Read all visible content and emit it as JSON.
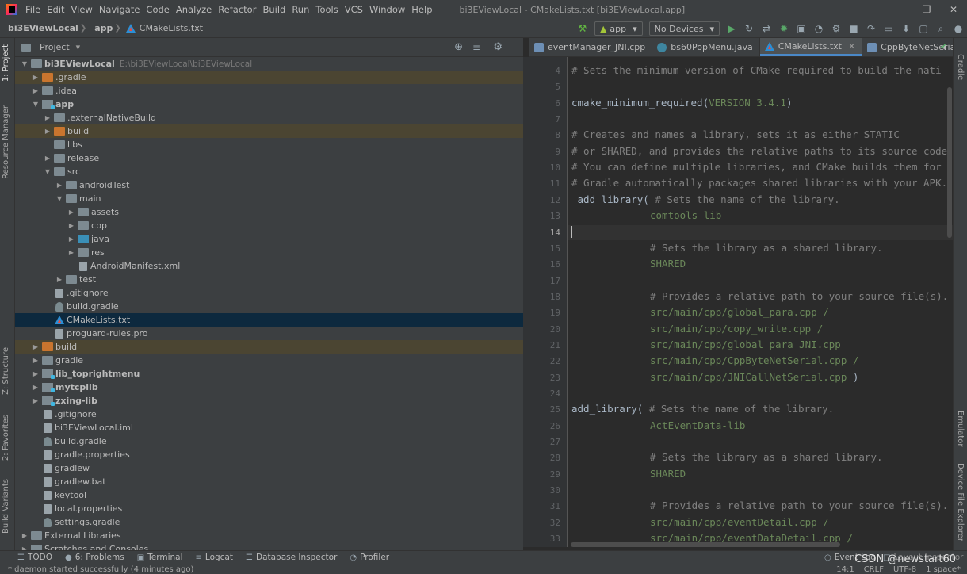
{
  "menubar": {
    "items": [
      "File",
      "Edit",
      "View",
      "Navigate",
      "Code",
      "Analyze",
      "Refactor",
      "Build",
      "Run",
      "Tools",
      "VCS",
      "Window",
      "Help"
    ],
    "title": "bi3EViewLocal - CMakeLists.txt [bi3EViewLocal.app]"
  },
  "navbar": {
    "crumbs": [
      "bi3EViewLocal",
      "app",
      "CMakeLists.txt"
    ],
    "run_config": "app",
    "device": "No Devices"
  },
  "left_strip": [
    "1: Project",
    "Resource Manager",
    "Z: Structure",
    "2: Favorites",
    "Build Variants"
  ],
  "right_strip": [
    "Gradle",
    "Emulator",
    "Device File Explorer"
  ],
  "project": {
    "title": "Project",
    "root_name": "bi3EViewLocal",
    "root_path": "E:\\bi3EViewLocal\\bi3EViewLocal",
    "rows": [
      {
        "label": ".gradle"
      },
      {
        "label": ".idea"
      },
      {
        "label": "app"
      },
      {
        "label": ".externalNativeBuild"
      },
      {
        "label": "build"
      },
      {
        "label": "libs"
      },
      {
        "label": "release"
      },
      {
        "label": "src"
      },
      {
        "label": "androidTest"
      },
      {
        "label": "main"
      },
      {
        "label": "assets"
      },
      {
        "label": "cpp"
      },
      {
        "label": "java"
      },
      {
        "label": "res"
      },
      {
        "label": "AndroidManifest.xml"
      },
      {
        "label": "test"
      },
      {
        "label": ".gitignore"
      },
      {
        "label": "build.gradle"
      },
      {
        "label": "CMakeLists.txt"
      },
      {
        "label": "proguard-rules.pro"
      },
      {
        "label": "build"
      },
      {
        "label": "gradle"
      },
      {
        "label": "lib_toprightmenu"
      },
      {
        "label": "mytcplib"
      },
      {
        "label": "zxing-lib"
      },
      {
        "label": ".gitignore"
      },
      {
        "label": "bi3EViewLocal.iml"
      },
      {
        "label": "build.gradle"
      },
      {
        "label": "gradle.properties"
      },
      {
        "label": "gradlew"
      },
      {
        "label": "gradlew.bat"
      },
      {
        "label": "keytool"
      },
      {
        "label": "local.properties"
      },
      {
        "label": "settings.gradle"
      },
      {
        "label": "External Libraries"
      },
      {
        "label": "Scratches and Consoles"
      }
    ]
  },
  "editor": {
    "tabs": [
      "eventManager_JNI.cpp",
      "bs60PopMenu.java",
      "CMakeLists.txt",
      "CppByteNetSerial."
    ],
    "active_tab": "CMakeLists.txt",
    "line_numbers": [
      "4",
      "5",
      "6",
      "7",
      "8",
      "9",
      "10",
      "11",
      "12",
      "13",
      "14",
      "15",
      "16",
      "17",
      "18",
      "19",
      "20",
      "21",
      "22",
      "23",
      "24",
      "25",
      "26",
      "27",
      "28",
      "29",
      "30",
      "31",
      "32",
      "33"
    ],
    "current_line": "14",
    "lines": {
      "l4": "# Sets the minimum version of CMake required to build the nati",
      "l6a": "cmake_minimum_required(",
      "l6b": "VERSION 3.4.1",
      "l6c": ")",
      "l8": "# Creates and names a library, sets it as either STATIC",
      "l9": "# or SHARED, and provides the relative paths to its source code",
      "l10": "# You can define multiple libraries, and CMake builds them for",
      "l11": "# Gradle automatically packages shared libraries with your APK.",
      "l12a": " add_library( ",
      "l12b": "# Sets the name of the library.",
      "l13": "comtools-lib",
      "l15": "# Sets the library as a shared library.",
      "l16": "SHARED",
      "l18": "# Provides a relative path to your source file(s).",
      "l19": "src/main/cpp/global_para.cpp /",
      "l20": "src/main/cpp/copy_write.cpp /",
      "l21": "src/main/cpp/global_para_JNI.cpp",
      "l22": "src/main/cpp/CppByteNetSerial.cpp /",
      "l23a": "src/main/cpp/JNICallNetSerial.cpp",
      "l23b": " )",
      "l25a": "add_library( ",
      "l25b": "# Sets the name of the library.",
      "l26": "ActEventData-lib",
      "l28": "# Sets the library as a shared library.",
      "l29": "SHARED",
      "l31": "# Provides a relative path to your source file(s).",
      "l32": "src/main/cpp/eventDetail.cpp /",
      "l33": "src/main/cpp/eventDataDetail.cpp /"
    }
  },
  "toolwindows": [
    "TODO",
    "6: Problems",
    "Terminal",
    "Logcat",
    "Database Inspector",
    "Profiler",
    "Event Log",
    "Layout Inspector"
  ],
  "status": {
    "message": "* daemon started successfully (4 minutes ago)",
    "position": "14:1",
    "line_sep": "CRLF",
    "encoding": "UTF-8",
    "indent": "1 space*"
  },
  "watermark": "CSDN @newstart60"
}
